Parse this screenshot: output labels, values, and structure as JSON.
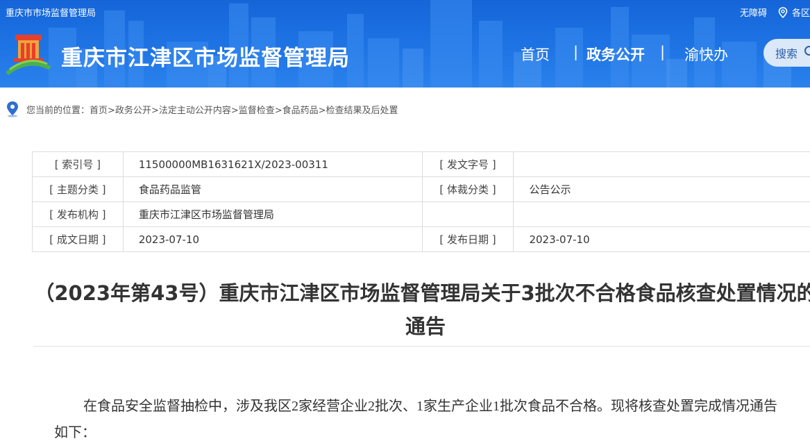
{
  "header": {
    "top_left_text": "重庆市市场监督管理局",
    "accessibility_link": "无障碍",
    "region_link": "各区",
    "site_title": "重庆市江津区市场监督管理局",
    "nav": {
      "home": "首页",
      "separator": "|",
      "gov_open": "政务公开",
      "yukuaiban": "渝快办"
    },
    "search_label": "搜索"
  },
  "breadcrumb": {
    "prefix": "您当前的位置：",
    "items": [
      "首页",
      ">政务公开",
      ">法定主动公开内容",
      ">监督检查",
      ">食品药品",
      ">检查结果及后处置"
    ]
  },
  "meta_table": {
    "rows": [
      [
        "[ 索引号 ]",
        "11500000MB1631621X/2023-00311",
        "[ 发文字号 ]",
        ""
      ],
      [
        "[ 主题分类 ]",
        "食品药品监管",
        "[ 体裁分类 ]",
        "公告公示"
      ],
      [
        "[ 发布机构 ]",
        "重庆市江津区市场监督管理局",
        "",
        ""
      ],
      [
        "[ 成文日期 ]",
        "2023-07-10",
        "[ 发布日期 ]",
        "2023-07-10"
      ]
    ]
  },
  "article": {
    "title": "（2023年第43号）重庆市江津区市场监督管理局关于3批次不合格食品核查处置情况的通告",
    "paragraph": "在食品安全监督抽检中，涉及我区2家经营企业2批次、1家生产企业1批次食品不合格。现将核查处置完成情况通告如下："
  },
  "colors": {
    "header_blue": "#1f74e4",
    "search_bg": "#dbe8f7",
    "location_icon": "#2f6fd0"
  }
}
